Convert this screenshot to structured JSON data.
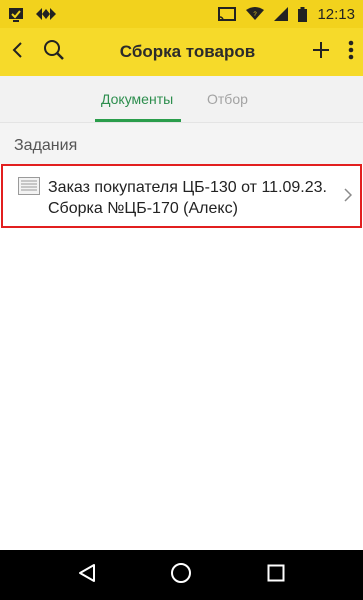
{
  "status_bar": {
    "time": "12:13",
    "icons": [
      "checkbox-icon",
      "usb-debug-icon",
      "cast-icon",
      "wifi-icon",
      "signal-icon",
      "battery-icon"
    ]
  },
  "app_bar": {
    "title": "Сборка товаров",
    "icons": [
      "back-icon",
      "search-icon",
      "add-icon",
      "more-icon"
    ]
  },
  "tabs": [
    {
      "label": "Документы",
      "active": true
    },
    {
      "label": "Отбор",
      "active": false
    }
  ],
  "section": {
    "title": "Задания"
  },
  "tasks": [
    {
      "text": "Заказ покупателя ЦБ-130 от 11.09.23. Сборка №ЦБ-170 (Алекс)"
    }
  ],
  "nav_bar": {
    "icons": [
      "back-triangle-icon",
      "home-circle-icon",
      "recents-square-icon"
    ]
  },
  "colors": {
    "status_bar": "#f2d21d",
    "app_bar": "#f6da2a",
    "tab_active": "#2d8e4e",
    "tab_inactive": "#a3a3a3",
    "highlight_border": "#e21f1f"
  }
}
